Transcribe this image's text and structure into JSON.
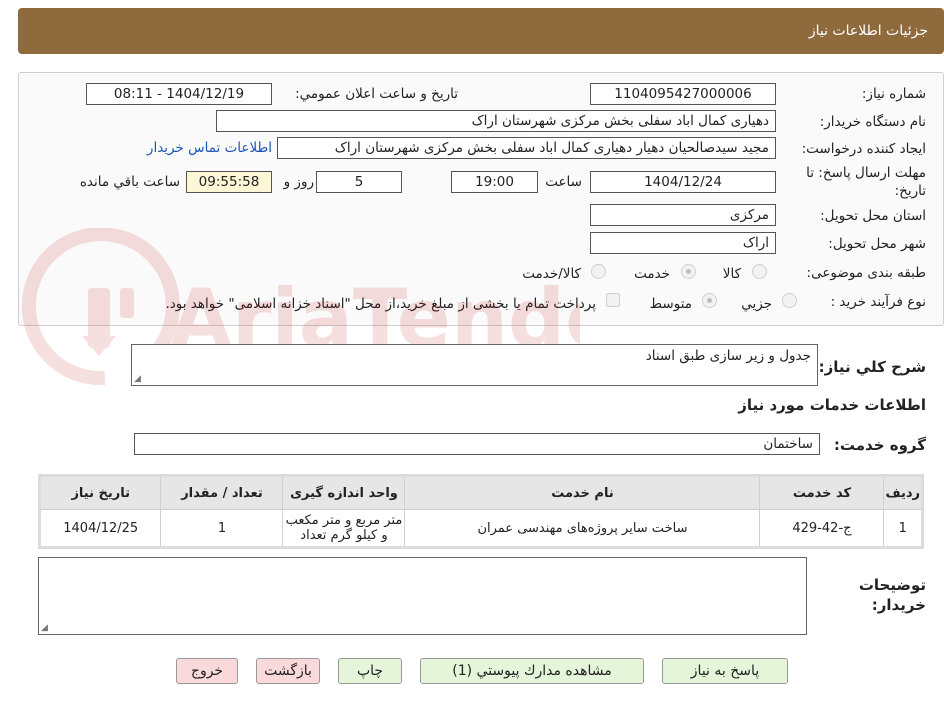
{
  "window": {
    "title": "جزئیات اطلاعات نیاز"
  },
  "form": {
    "need_number_label": "شماره نياز:",
    "need_number": "1104095427000006",
    "announce_label": "تاريخ و ساعت اعلان عمومي:",
    "announce_value": "1404/12/19 - 08:11",
    "buyer_org_label": "نام دستگاه خريدار:",
    "buyer_org": "دهیاری کمال اباد سفلی بخش مرکزی  شهرستان اراک",
    "requester_label": "ايجاد کننده درخواست:",
    "requester": "مجید سیدصالحیان دهیار دهیاری کمال اباد سفلی بخش مرکزی  شهرستان اراک",
    "contact_link": "اطلاعات تماس خريدار",
    "deadline_label_line1": "مهلت ارسال پاسخ: تا",
    "deadline_label_line2": "تاريخ:",
    "deadline_date": "1404/12/24",
    "time_label": "ساعت",
    "deadline_time": "19:00",
    "days_value": "5",
    "days_label": "روز و",
    "remaining_time": "09:55:58",
    "remaining_label": "ساعت باقي مانده",
    "province_label": "استان محل تحويل:",
    "province": "مرکزی",
    "city_label": "شهر محل تحويل:",
    "city": "اراک",
    "category_label": "طبقه بندی موضوعی:",
    "category_options": [
      "کالا",
      "خدمت",
      "کالا/خدمت"
    ],
    "process_label": "نوع فرآيند خريد :",
    "process_options": [
      "جزيي",
      "متوسط"
    ],
    "payment_note": "پرداخت تمام یا بخشی از مبلغ خرید،از محل \"اسناد خزانه اسلامی\" خواهد بود."
  },
  "description": {
    "label": "شرح کلي نياز:",
    "value": "جدول و زیر سازی طبق اسناد"
  },
  "services": {
    "section_title": "اطلاعات خدمات مورد نياز",
    "group_label": "گروه خدمت:",
    "group_value": "ساختمان",
    "headers": [
      "رديف",
      "کد خدمت",
      "نام خدمت",
      "واحد اندازه گيری",
      "تعداد / مقدار",
      "تاريخ نياز"
    ],
    "rows": [
      {
        "row": "1",
        "code": "ج-42-429",
        "name": "ساخت سایر پروژه‌های مهندسی عمران",
        "unit_line1": "متر مربع و متر مکعب",
        "unit_line2": "و کیلو گرم تعداد",
        "quantity": "1",
        "date": "1404/12/25"
      }
    ]
  },
  "buyer_notes": {
    "label_line1": "توضيحات",
    "label_line2": "خريدار:",
    "value": ""
  },
  "buttons": {
    "reply": "پاسخ به نياز",
    "attachments": "مشاهده مدارك پيوستي (1)",
    "print": "چاپ",
    "back": "بازگشت",
    "exit": "خروج"
  },
  "watermark": {
    "text": "AriaTender.neT"
  },
  "colors": {
    "title_bar": "#8e6a3d",
    "link": "#1a54b8",
    "button_green": "#e4f5da",
    "button_pink": "#f9d9d9",
    "time_box": "#fdf7d6"
  }
}
